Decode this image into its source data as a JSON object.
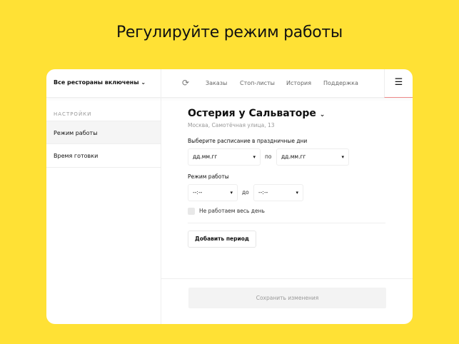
{
  "headline": "Регулируйте режим работы",
  "header": {
    "restaurants": "Все рестораны включены",
    "chevron": "⌄",
    "nav": [
      "Заказы",
      "Стоп-листы",
      "История",
      "Поддержка"
    ],
    "menu_icon": "☰",
    "refresh_icon": "⟳"
  },
  "sidebar": {
    "heading": "НАСТРОЙКИ",
    "items": [
      {
        "label": "Режим работы",
        "active": true
      },
      {
        "label": "Время готовки",
        "active": false
      }
    ]
  },
  "main": {
    "title": "Остерия у Сальваторе",
    "address": "Москва, Самотёчная улица, 13",
    "holiday_label": "Выберите расписание в праздничные дни",
    "date_from": "дд.мм.гг",
    "date_sep": "по",
    "date_to": "дд.мм.гг",
    "hours_label": "Режим работы",
    "time_from": "--:--",
    "time_sep": "до",
    "time_to": "--:--",
    "closed_all_day": "Не работаем весь день",
    "add_period": "Добавить период",
    "save": "Сохранить изменения"
  },
  "colors": {
    "background": "#ffe135",
    "accent_underline": "#e88888"
  }
}
